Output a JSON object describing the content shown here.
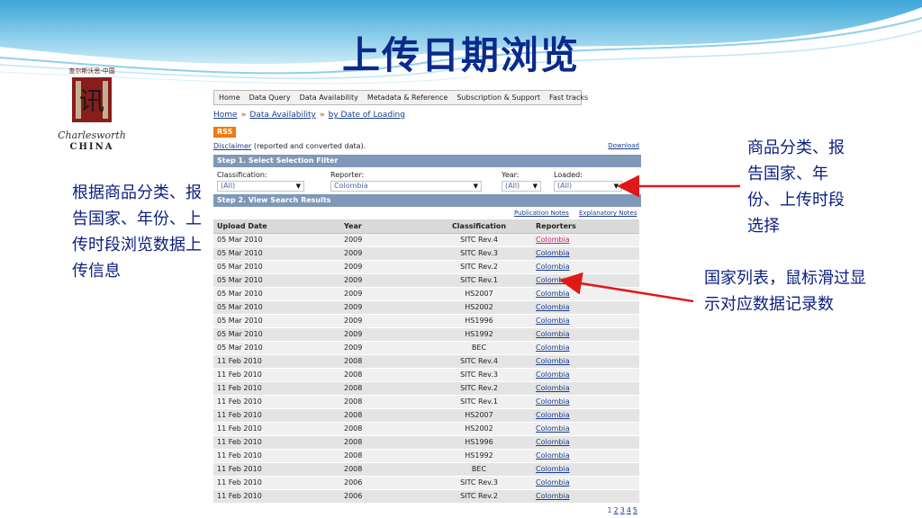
{
  "slide": {
    "title": "上传日期浏览",
    "note_left": "根据商品分类、报告国家、年份、上传时段浏览数据上传信息",
    "note_right_top": "商品分类、报告国家、年份、上传时段选择",
    "note_right_mid": "国家列表，鼠标滑过显示对应数据记录数"
  },
  "logo": {
    "top_text": "查尔斯沃思·中国",
    "seal_char": "讯",
    "script": "Charlesworth",
    "china": "CHINA"
  },
  "nav": [
    "Home",
    "Data Query",
    "Data Availability",
    "Metadata & Reference",
    "Subscription & Support",
    "Fast tracks"
  ],
  "breadcrumb": {
    "home": "Home",
    "availability": "Data Availability",
    "current": "by Date of Loading",
    "sep": "»"
  },
  "rss": "RSS",
  "disclaimer": {
    "link": "Disclaimer",
    "text": " (reported and converted data).",
    "download": "Download"
  },
  "step1": "Step 1. Select Selection Filter",
  "filters": {
    "classification": {
      "label": "Classification:",
      "value": "(All)"
    },
    "reporter": {
      "label": "Reporter:",
      "value": "Colombia"
    },
    "year": {
      "label": "Year:",
      "value": "(All)"
    },
    "loaded": {
      "label": "Loaded:",
      "value": "(All)"
    }
  },
  "step2": "Step 2. View Search Results",
  "notes": {
    "publication": "Publication Notes",
    "explanatory": "Explanatory Notes"
  },
  "table": {
    "headers": [
      "Upload Date",
      "Year",
      "Classification",
      "Reporters"
    ],
    "rows": [
      [
        "05 Mar 2010",
        "2009",
        "SITC Rev.4",
        "Colombia"
      ],
      [
        "05 Mar 2010",
        "2009",
        "SITC Rev.3",
        "Colombia"
      ],
      [
        "05 Mar 2010",
        "2009",
        "SITC Rev.2",
        "Colombia"
      ],
      [
        "05 Mar 2010",
        "2009",
        "SITC Rev.1",
        "Colombia"
      ],
      [
        "05 Mar 2010",
        "2009",
        "HS2007",
        "Colombia"
      ],
      [
        "05 Mar 2010",
        "2009",
        "HS2002",
        "Colombia"
      ],
      [
        "05 Mar 2010",
        "2009",
        "HS1996",
        "Colombia"
      ],
      [
        "05 Mar 2010",
        "2009",
        "HS1992",
        "Colombia"
      ],
      [
        "05 Mar 2010",
        "2009",
        "BEC",
        "Colombia"
      ],
      [
        "11 Feb 2010",
        "2008",
        "SITC Rev.4",
        "Colombia"
      ],
      [
        "11 Feb 2010",
        "2008",
        "SITC Rev.3",
        "Colombia"
      ],
      [
        "11 Feb 2010",
        "2008",
        "SITC Rev.2",
        "Colombia"
      ],
      [
        "11 Feb 2010",
        "2008",
        "SITC Rev.1",
        "Colombia"
      ],
      [
        "11 Feb 2010",
        "2008",
        "HS2007",
        "Colombia"
      ],
      [
        "11 Feb 2010",
        "2008",
        "HS2002",
        "Colombia"
      ],
      [
        "11 Feb 2010",
        "2008",
        "HS1996",
        "Colombia"
      ],
      [
        "11 Feb 2010",
        "2008",
        "HS1992",
        "Colombia"
      ],
      [
        "11 Feb 2010",
        "2008",
        "BEC",
        "Colombia"
      ],
      [
        "11 Feb 2010",
        "2006",
        "SITC Rev.3",
        "Colombia"
      ],
      [
        "11 Feb 2010",
        "2006",
        "SITC Rev.2",
        "Colombia"
      ]
    ]
  },
  "pager": [
    "1",
    "2",
    "3",
    "4",
    "5"
  ],
  "colors": {
    "title": "#0b2a8c",
    "note": "#0b1e80",
    "arrow": "#e01818",
    "stepbar": "#7f98b8",
    "rss": "#f07a10"
  }
}
